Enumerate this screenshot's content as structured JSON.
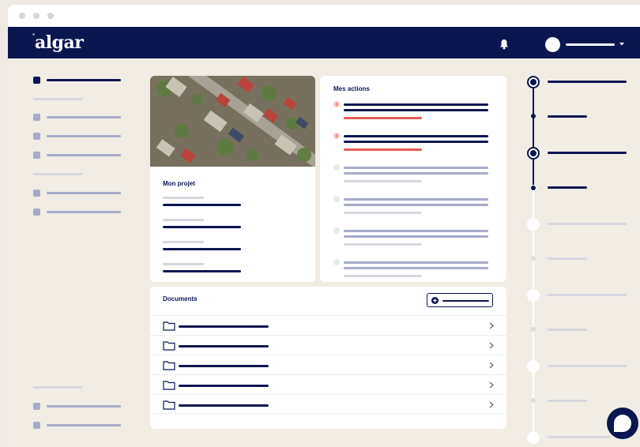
{
  "app": {
    "brand": "algar",
    "brand_star": "*"
  },
  "colors": {
    "navy": "#0b1650",
    "slate": "#a6abc8",
    "red": "#e35b55",
    "background": "#f1ece4"
  },
  "icons": {
    "bell": "bell-icon",
    "folder": "folder-icon",
    "chevron": "chevron-right-icon",
    "add": "plus-circle-icon",
    "chat": "chat-icon"
  },
  "cards": {
    "project_title": "Mon projet",
    "actions_title": "Mes actions",
    "documents_title": "Documents"
  }
}
